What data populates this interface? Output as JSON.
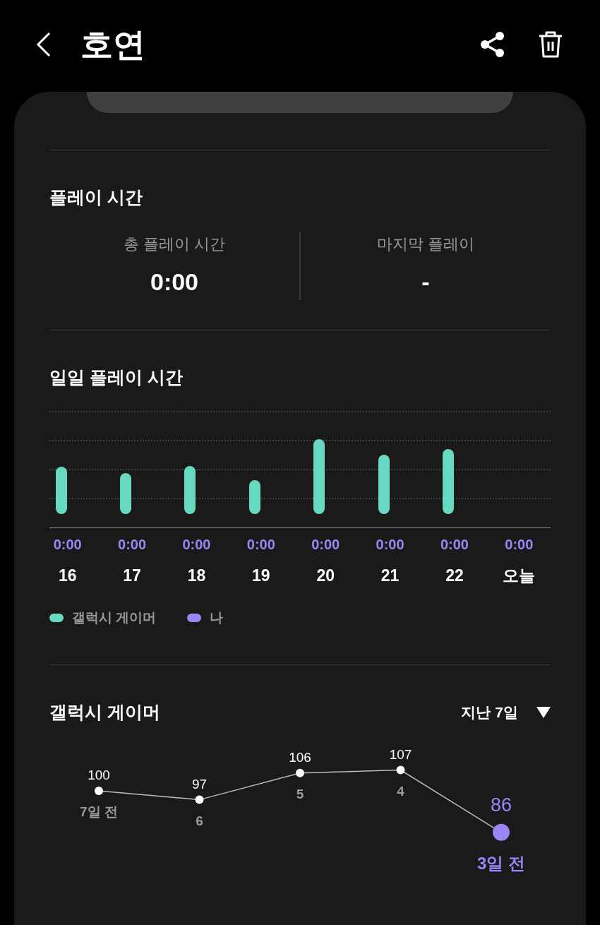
{
  "header": {
    "title": "호연"
  },
  "play_time": {
    "title": "플레이 시간",
    "stats": [
      {
        "label": "총 플레이 시간",
        "value": "0:00"
      },
      {
        "label": "마지막 플레이",
        "value": "-"
      }
    ]
  },
  "daily": {
    "title": "일일 플레이 시간",
    "days": [
      {
        "my_time": "0:00",
        "day": "16"
      },
      {
        "my_time": "0:00",
        "day": "17"
      },
      {
        "my_time": "0:00",
        "day": "18"
      },
      {
        "my_time": "0:00",
        "day": "19"
      },
      {
        "my_time": "0:00",
        "day": "20"
      },
      {
        "my_time": "0:00",
        "day": "21"
      },
      {
        "my_time": "0:00",
        "day": "22"
      },
      {
        "my_time": "0:00",
        "day": "오늘"
      }
    ],
    "legend": [
      {
        "label": "갤럭시 게이머",
        "color": "#67d9c0"
      },
      {
        "label": "나",
        "color": "#9b86f5"
      }
    ]
  },
  "ranking": {
    "title": "갤럭시 게이머",
    "period": "지난 7일",
    "chart_data": {
      "type": "line",
      "categories": [
        "7일 전",
        "6",
        "5",
        "4",
        "3일 전"
      ],
      "values": [
        100,
        97,
        106,
        107,
        86
      ],
      "data_labels": true,
      "marker": "circle"
    }
  }
}
